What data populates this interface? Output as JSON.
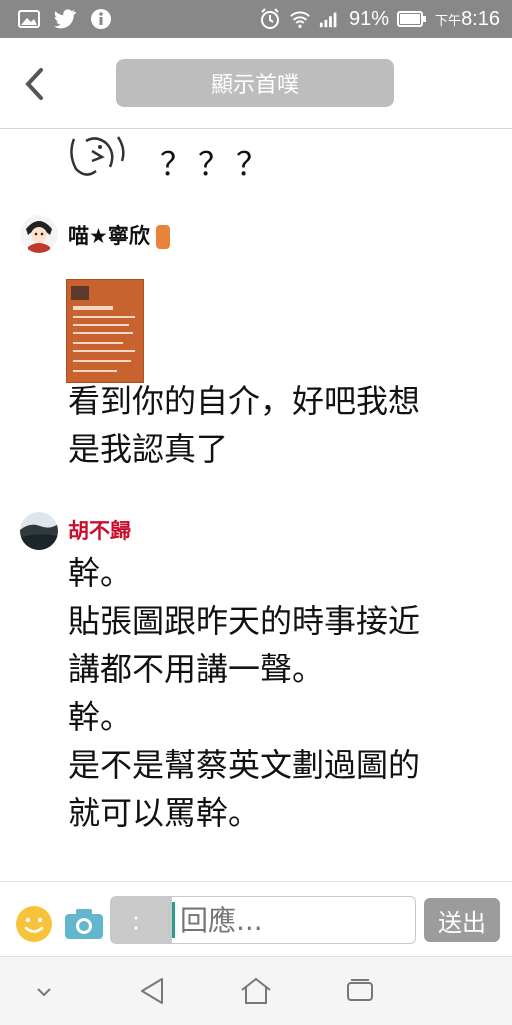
{
  "status": {
    "battery": "91%",
    "ampm": "下午",
    "time": "8:16",
    "icons": [
      "gallery-icon",
      "twitter-icon",
      "info-icon",
      "alarm-icon",
      "wifi-icon",
      "signal-icon",
      "battery-icon"
    ]
  },
  "header": {
    "back_icon": "back-arrow-icon",
    "title_button": "顯示首噗"
  },
  "feed": {
    "partial_text": "？？？",
    "responses": [
      {
        "name": "喵★寧欣",
        "name_color": "#111111",
        "badge_color": "#e8833a",
        "has_image": true,
        "lines": [
          "看到你的自介，好吧我想",
          "是我認真了"
        ]
      },
      {
        "name": "胡不歸",
        "name_color": "#c8102e",
        "lines": [
          "幹。",
          "貼張圖跟昨天的時事接近",
          "講都不用講一聲。",
          "幹。",
          "是不是幫蔡英文劃過圖的",
          "就可以罵幹。"
        ]
      }
    ]
  },
  "reply_bar": {
    "emoji_icon": "smile-icon",
    "camera_icon": "camera-icon",
    "qualifier": "：",
    "placeholder": "回應...",
    "send_label": "送出"
  },
  "navbar": {
    "icons": [
      "hide-keyboard-icon",
      "back-icon",
      "home-icon",
      "recents-icon"
    ]
  }
}
